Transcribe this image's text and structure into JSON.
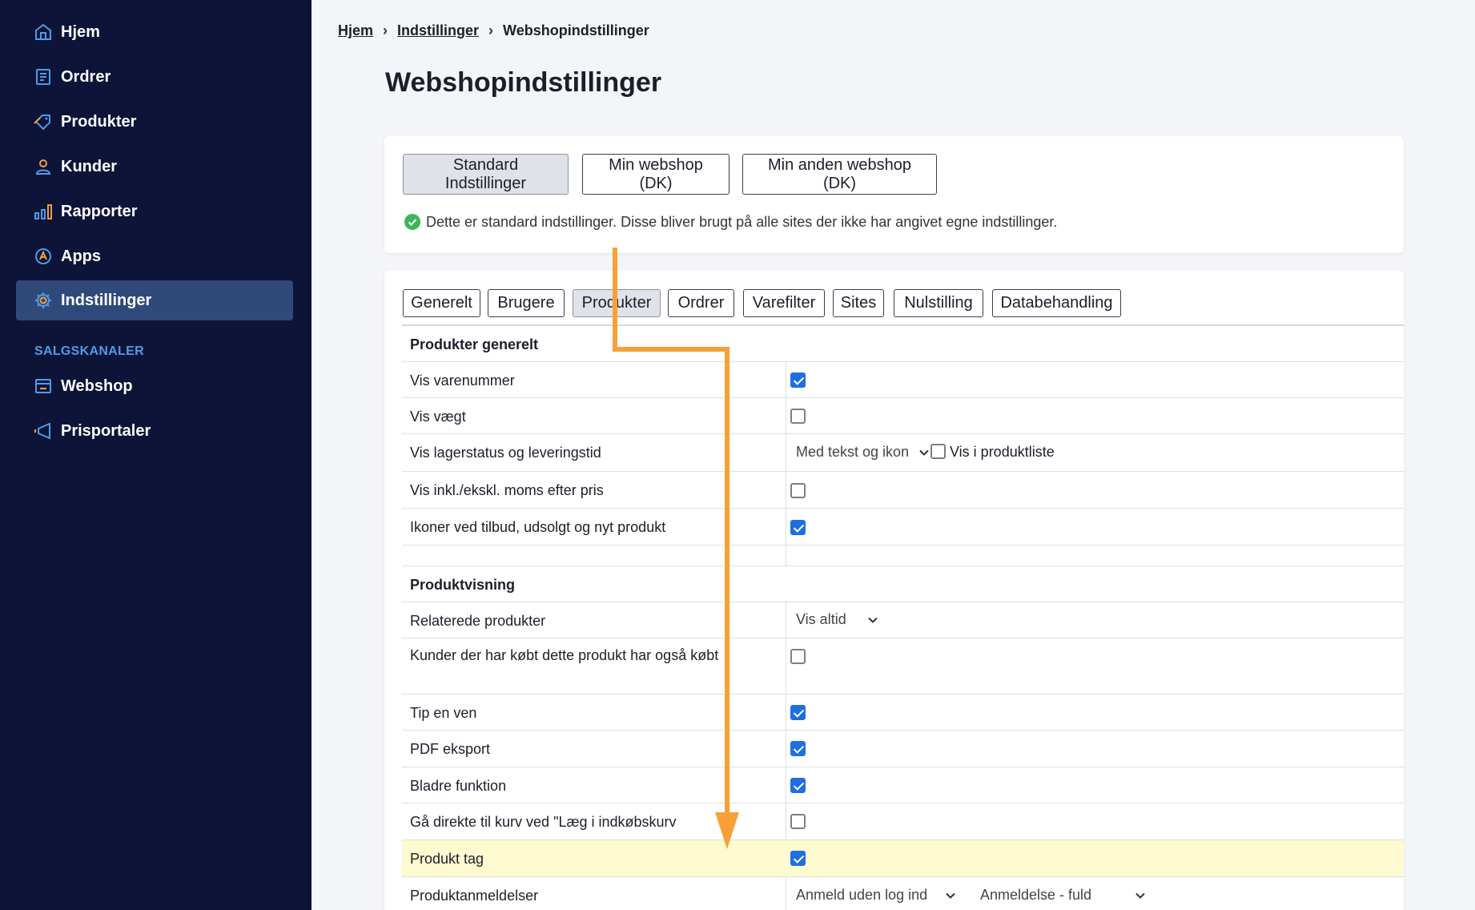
{
  "sidebar": {
    "items": [
      {
        "label": "Hjem",
        "icon": "home-icon"
      },
      {
        "label": "Ordrer",
        "icon": "orders-icon"
      },
      {
        "label": "Produkter",
        "icon": "tag-icon"
      },
      {
        "label": "Kunder",
        "icon": "user-icon"
      },
      {
        "label": "Rapporter",
        "icon": "bar-chart-icon"
      },
      {
        "label": "Apps",
        "icon": "apps-icon"
      },
      {
        "label": "Indstillinger",
        "icon": "gear-icon",
        "active": true
      }
    ],
    "section_label": "SALGSKANALER",
    "channels": [
      {
        "label": "Webshop",
        "icon": "webshop-icon"
      },
      {
        "label": "Prisportaler",
        "icon": "megaphone-icon"
      }
    ]
  },
  "breadcrumb": {
    "items": [
      "Hjem",
      "Indstillinger"
    ],
    "current": "Webshopindstillinger"
  },
  "page_title": "Webshopindstillinger",
  "sites": {
    "buttons": [
      "Standard Indstillinger",
      "Min webshop (DK)",
      "Min anden webshop (DK)"
    ],
    "active": "Standard Indstillinger",
    "info": "Dette er standard indstillinger. Disse bliver brugt på alle sites der ikke har angivet egne indstillinger."
  },
  "tabs": {
    "items": [
      "Generelt",
      "Brugere",
      "Produkter",
      "Ordrer",
      "Varefilter",
      "Sites",
      "Nulstilling",
      "Databehandling"
    ],
    "active": "Produkter"
  },
  "sections": {
    "general": {
      "title": "Produkter generelt",
      "rows": [
        {
          "label": "Vis varenummer",
          "checked": true
        },
        {
          "label": "Vis vægt",
          "checked": false
        },
        {
          "label": "Vis lagerstatus og leveringstid",
          "select": "Med tekst og ikon",
          "extra_checkbox_label": "Vis i produktliste",
          "extra_checked": false
        },
        {
          "label": "Vis inkl./ekskl. moms efter pris",
          "checked": false
        },
        {
          "label": "Ikoner ved tilbud, udsolgt og nyt produkt",
          "checked": true
        }
      ]
    },
    "display": {
      "title": "Produktvisning",
      "rows": [
        {
          "label": "Relaterede produkter",
          "select": "Vis altid"
        },
        {
          "label": "Kunder der har købt dette produkt har også købt",
          "checked": false
        },
        {
          "label": "Tip en ven",
          "checked": true
        },
        {
          "label": "PDF eksport",
          "checked": true
        },
        {
          "label": "Bladre funktion",
          "checked": true
        },
        {
          "label": "Gå direkte til kurv ved \"Læg i indkøbskurv",
          "checked": false
        },
        {
          "label": "Produkt tag",
          "checked": true,
          "highlighted": true
        },
        {
          "label": "Produktanmeldelser",
          "select": "Anmeld uden log ind",
          "select2": "Anmeldelse - fuld"
        }
      ]
    }
  },
  "colors": {
    "sidebar_bg": "#0d1438",
    "sidebar_active": "#2f4a7a",
    "accent_blue": "#1f6fe0",
    "annotation_arrow": "#f7a035",
    "highlight_row": "#fdfbcf",
    "success_green": "#3db55a"
  }
}
